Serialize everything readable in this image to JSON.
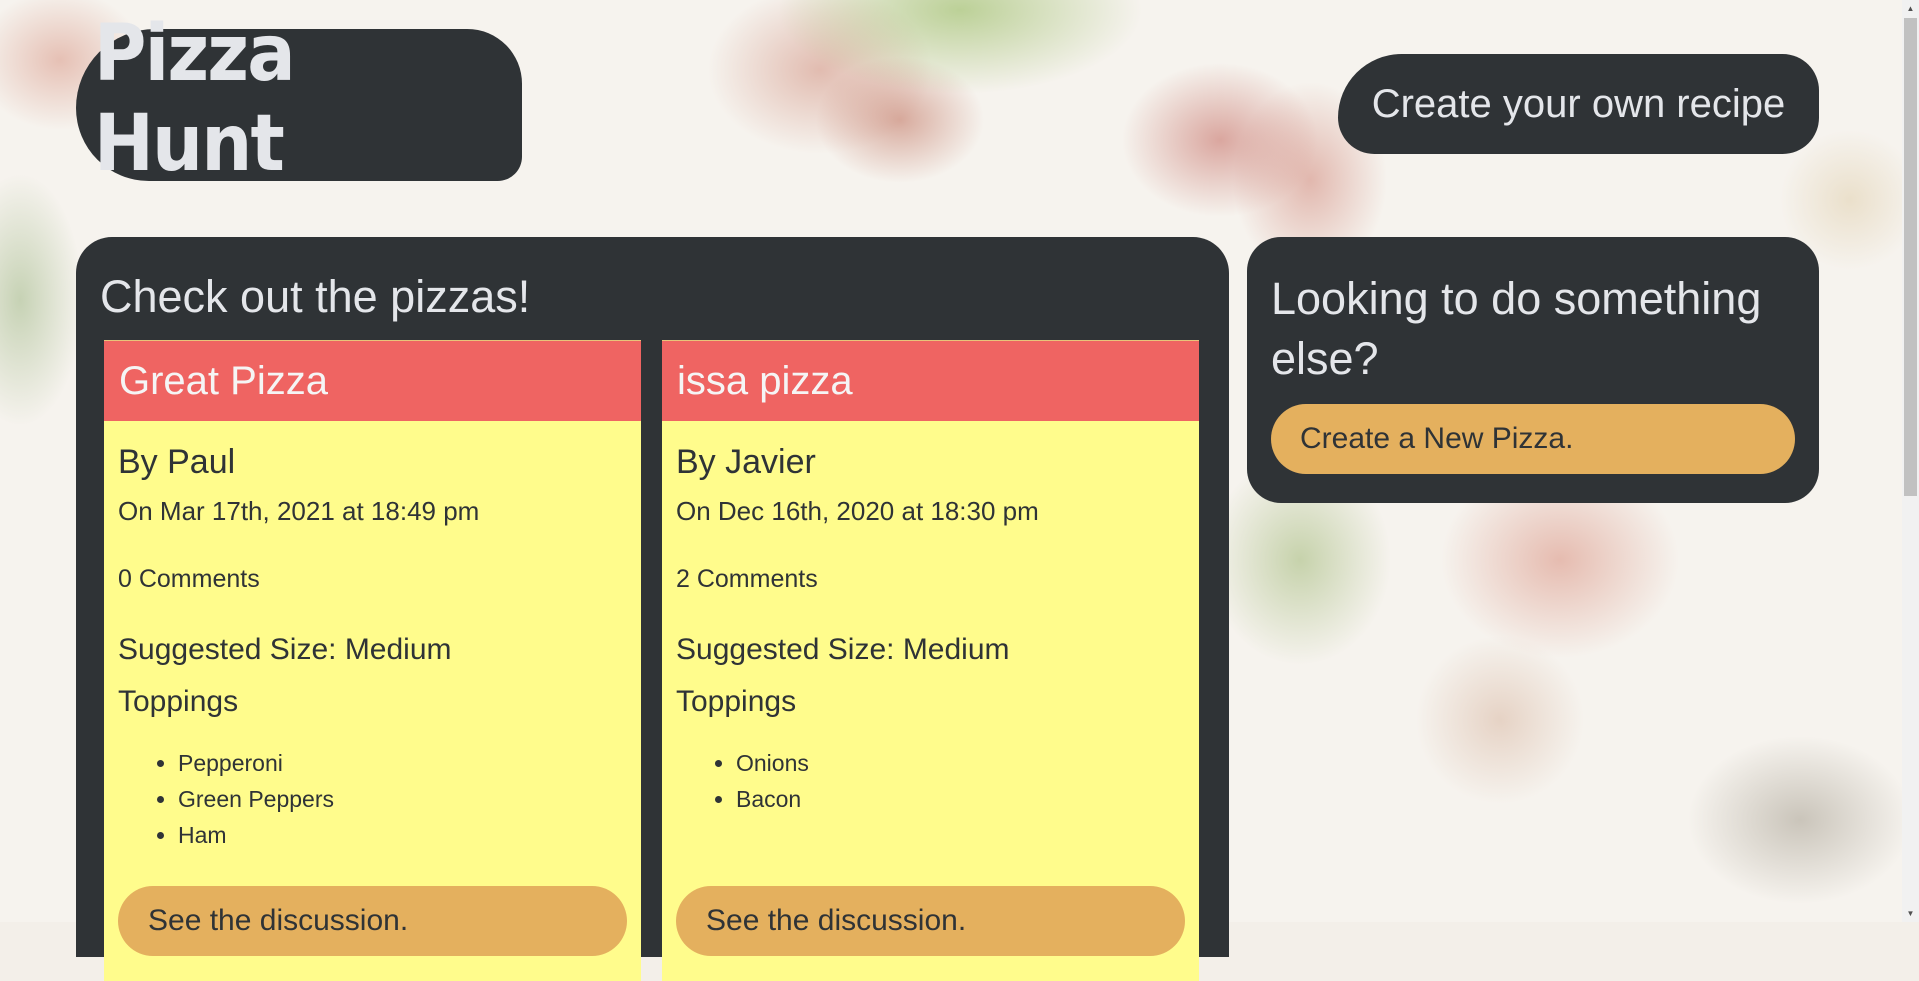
{
  "header": {
    "logo": "Pizza Hunt",
    "recipe_link": "Create your own recipe"
  },
  "main": {
    "heading": "Check out the pizzas!",
    "pizzas": [
      {
        "name": "Great Pizza",
        "by": "By Paul",
        "date": "On Mar 17th, 2021 at 18:49 pm",
        "comments": "0 Comments",
        "size": "Suggested Size: Medium",
        "toppings_label": "Toppings",
        "toppings": [
          "Pepperoni",
          "Green Peppers",
          "Ham"
        ],
        "discussion_button": "See the discussion."
      },
      {
        "name": "issa pizza",
        "by": "By Javier",
        "date": "On Dec 16th, 2020 at 18:30 pm",
        "comments": "2 Comments",
        "size": "Suggested Size: Medium",
        "toppings_label": "Toppings",
        "toppings": [
          "Onions",
          "Bacon"
        ],
        "discussion_button": "See the discussion."
      }
    ]
  },
  "sidebar": {
    "heading": "Looking to do something else?",
    "button": "Create a New Pizza."
  },
  "colors": {
    "panel": "#2f3336",
    "card_header": "#ef6462",
    "card_body": "#fffc8c",
    "button": "#e4b05e",
    "text_light": "#e4e6ea"
  },
  "icons": {
    "scroll_up": "▲",
    "scroll_down": "▼"
  }
}
